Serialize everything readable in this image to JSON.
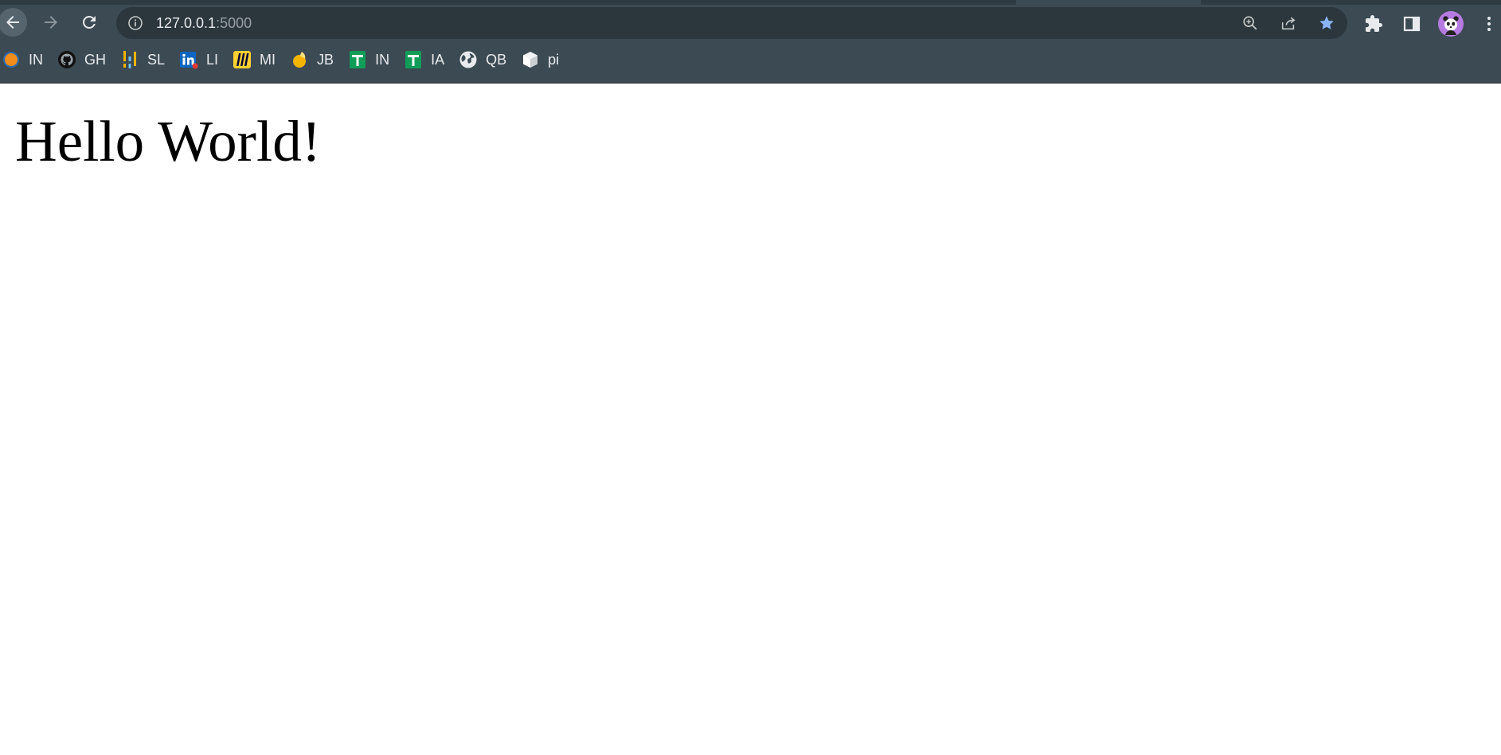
{
  "address_bar": {
    "host": "127.0.0.1",
    "port": ":5000"
  },
  "bookmarks": [
    {
      "label": "IN",
      "icon": "orange-circle-icon"
    },
    {
      "label": "GH",
      "icon": "github-icon"
    },
    {
      "label": "SL",
      "icon": "bars-icon"
    },
    {
      "label": "LI",
      "icon": "linkedin-icon"
    },
    {
      "label": "MI",
      "icon": "miro-icon"
    },
    {
      "label": "JB",
      "icon": "drop-icon"
    },
    {
      "label": "IN",
      "icon": "green-sheet-icon"
    },
    {
      "label": "IA",
      "icon": "green-sheet-icon"
    },
    {
      "label": "QB",
      "icon": "globe-icon"
    },
    {
      "label": "pi",
      "icon": "cube-icon"
    }
  ],
  "page": {
    "heading": "Hello World!"
  },
  "colors": {
    "chrome": "#3c4a53",
    "omnibox": "#2b363d",
    "star": "#8ab4f8",
    "avatar": "#b57be0"
  }
}
